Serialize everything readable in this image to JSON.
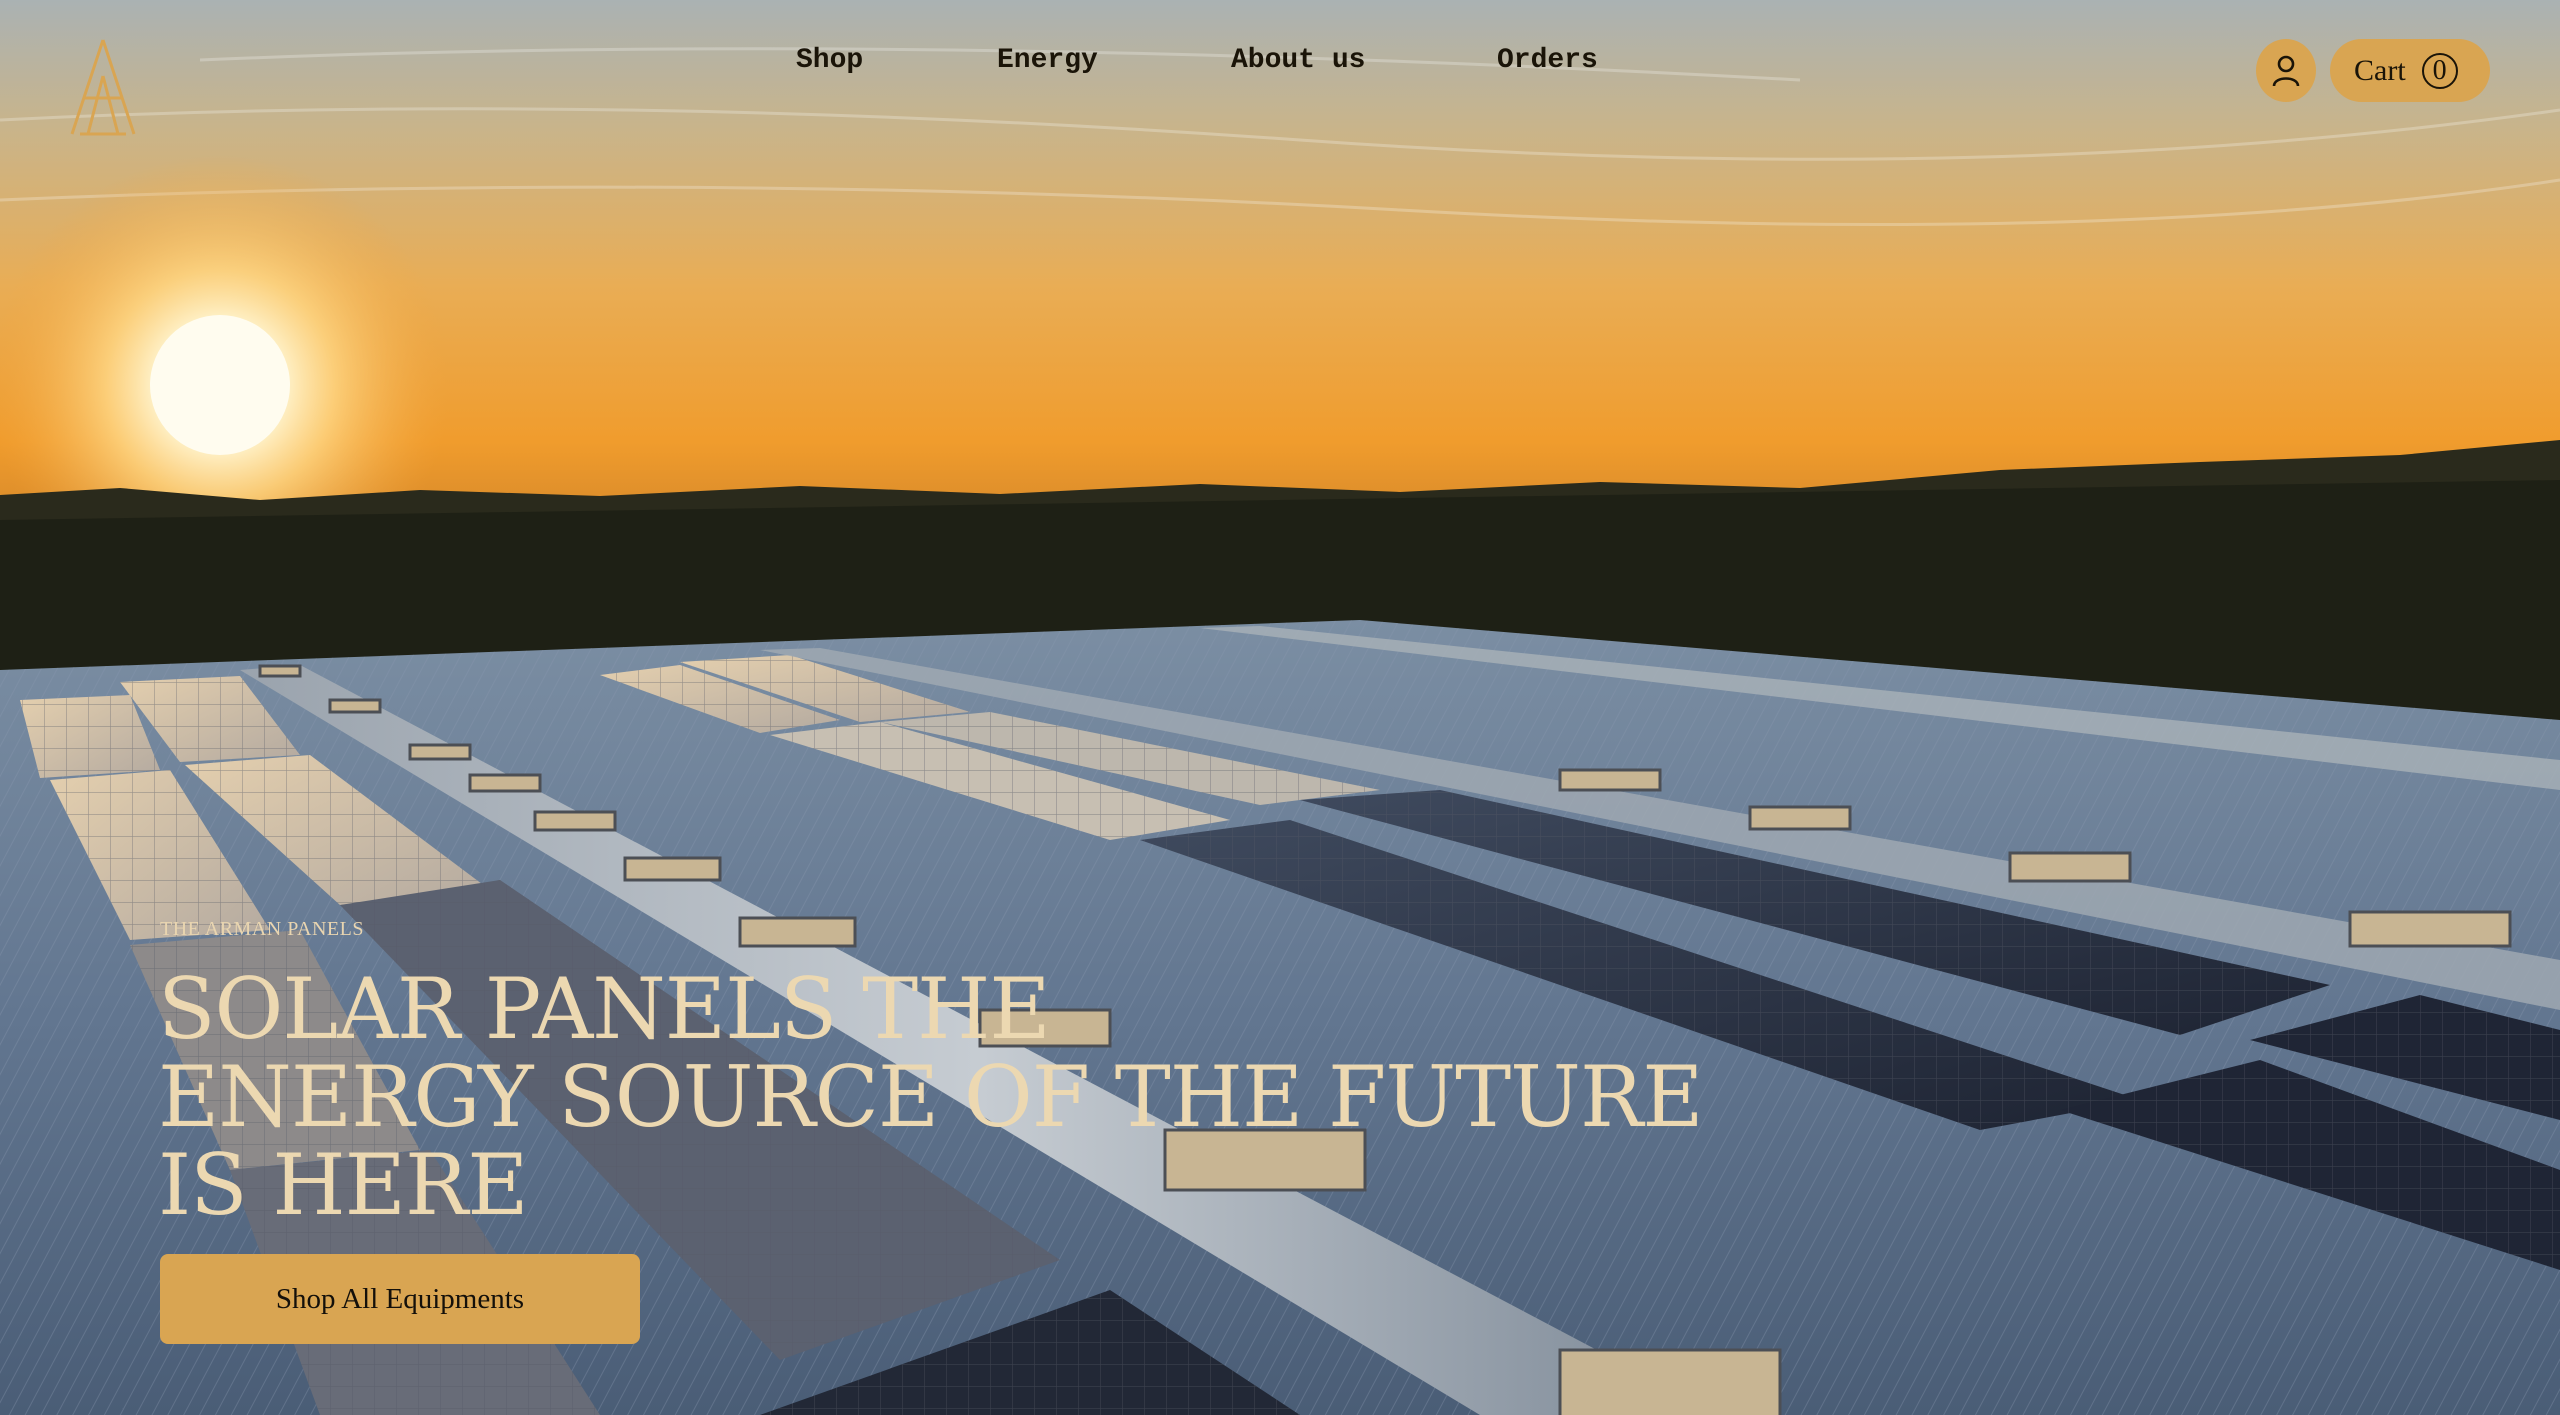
{
  "brand": {
    "logo_icon": "stacked-triangles-logo-icon",
    "accent": "#d9a552"
  },
  "nav": {
    "items": [
      {
        "label": "Shop"
      },
      {
        "label": "Energy"
      },
      {
        "label": "About us"
      },
      {
        "label": "Orders"
      }
    ]
  },
  "header": {
    "user_icon": "user-icon",
    "cart": {
      "label": "Cart",
      "count": "0"
    }
  },
  "hero": {
    "eyebrow": "THE ARMAN PANELS",
    "headline_lines": [
      "SOLAR PANELS THE",
      "ENERGY SOURCE OF THE FUTURE",
      "IS HERE"
    ],
    "cta_label": "Shop All Equipments",
    "text_color": "#ecd8b1"
  }
}
